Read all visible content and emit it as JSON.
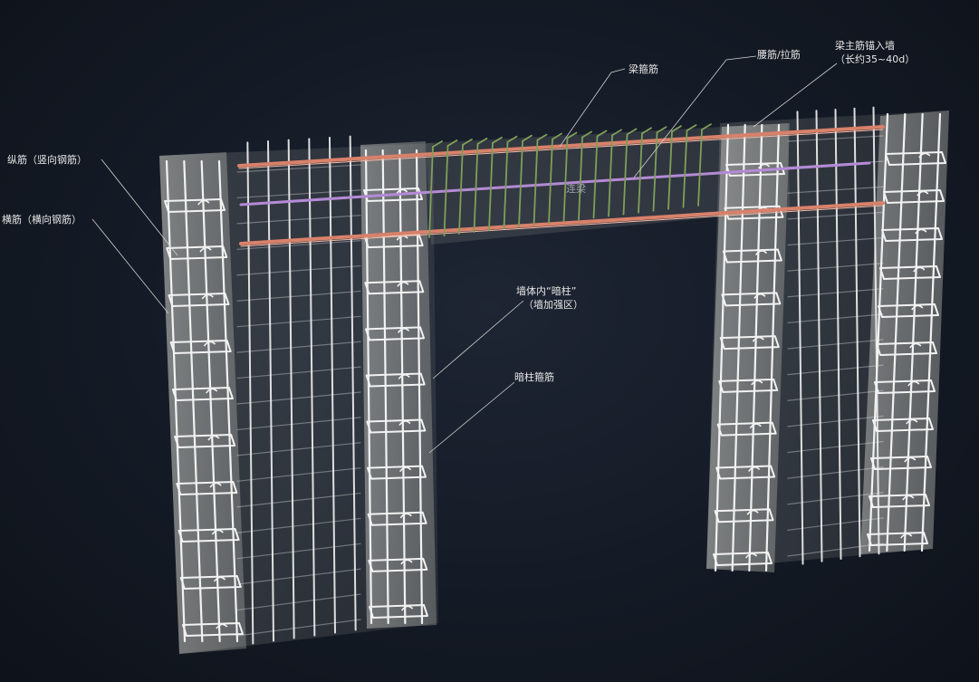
{
  "labels": {
    "longitudinal": "纵筋（竖向钢筋）",
    "transverse": "横筋（横向钢筋）",
    "beam_stirrup": "梁箍筋",
    "waist_bar": "腰筋/拉筋",
    "anchor_line1": "梁主筋锚入墙",
    "anchor_line2": "（长约35~40d）",
    "hidden_column_line1": "墙体内“暗柱”",
    "hidden_column_line2": "（墙加强区）",
    "hidden_column_stirrup": "暗柱箍筋",
    "connecting_beam": "连梁"
  },
  "colors": {
    "rebar_white": "#f2f2f2",
    "main_bar": "#d9816a",
    "waist_bar": "#b48ad6",
    "beam_stirrup": "#7f9f5a",
    "concrete_fill": "#d8d8d0",
    "background": "#141a25"
  },
  "icons": {
    "stirrup_hook": "hook-icon"
  }
}
